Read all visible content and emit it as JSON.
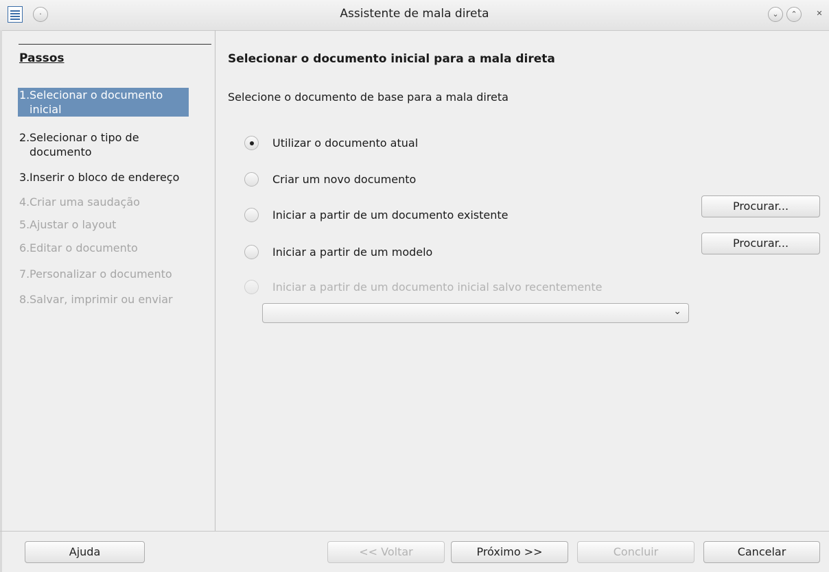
{
  "window": {
    "title": "Assistente de mala direta"
  },
  "titlebar_buttons": {
    "menu_glyph": "·",
    "minimize_glyph": "⌄",
    "maximize_glyph": "⌃",
    "close_glyph": "✕"
  },
  "steps": {
    "title": "Passos",
    "items": [
      {
        "num": "1.",
        "label": "Selecionar o documento inicial"
      },
      {
        "num": "2.",
        "label": "Selecionar o tipo de documento"
      },
      {
        "num": "3.",
        "label": "Inserir o bloco de endereço"
      },
      {
        "num": "4.",
        "label": "Criar uma saudação"
      },
      {
        "num": "5.",
        "label": "Ajustar o layout"
      },
      {
        "num": "6.",
        "label": "Editar o documento"
      },
      {
        "num": "7.",
        "label": "Personalizar o documento"
      },
      {
        "num": "8.",
        "label": "Salvar, imprimir ou enviar"
      }
    ]
  },
  "main": {
    "heading": "Selecionar o documento inicial para a mala direta",
    "subheading": "Selecione o documento de base para a mala direta",
    "options": [
      {
        "label": "Utilizar o documento atual",
        "checked": true
      },
      {
        "label": "Criar um novo documento",
        "checked": false
      },
      {
        "label": "Iniciar a partir de um documento existente",
        "checked": false
      },
      {
        "label": "Iniciar a partir de um modelo",
        "checked": false
      },
      {
        "label": "Iniciar a partir de um documento inicial salvo recentemente",
        "checked": false,
        "disabled": true
      }
    ],
    "browse_existing_label": "Procurar...",
    "browse_template_label": "Procurar...",
    "recent_select_value": "",
    "recent_select_chevron": "⌄"
  },
  "footer": {
    "help": "Ajuda",
    "back": "<< Voltar",
    "next": "Próximo >>",
    "finish": "Concluir",
    "cancel": "Cancelar"
  }
}
